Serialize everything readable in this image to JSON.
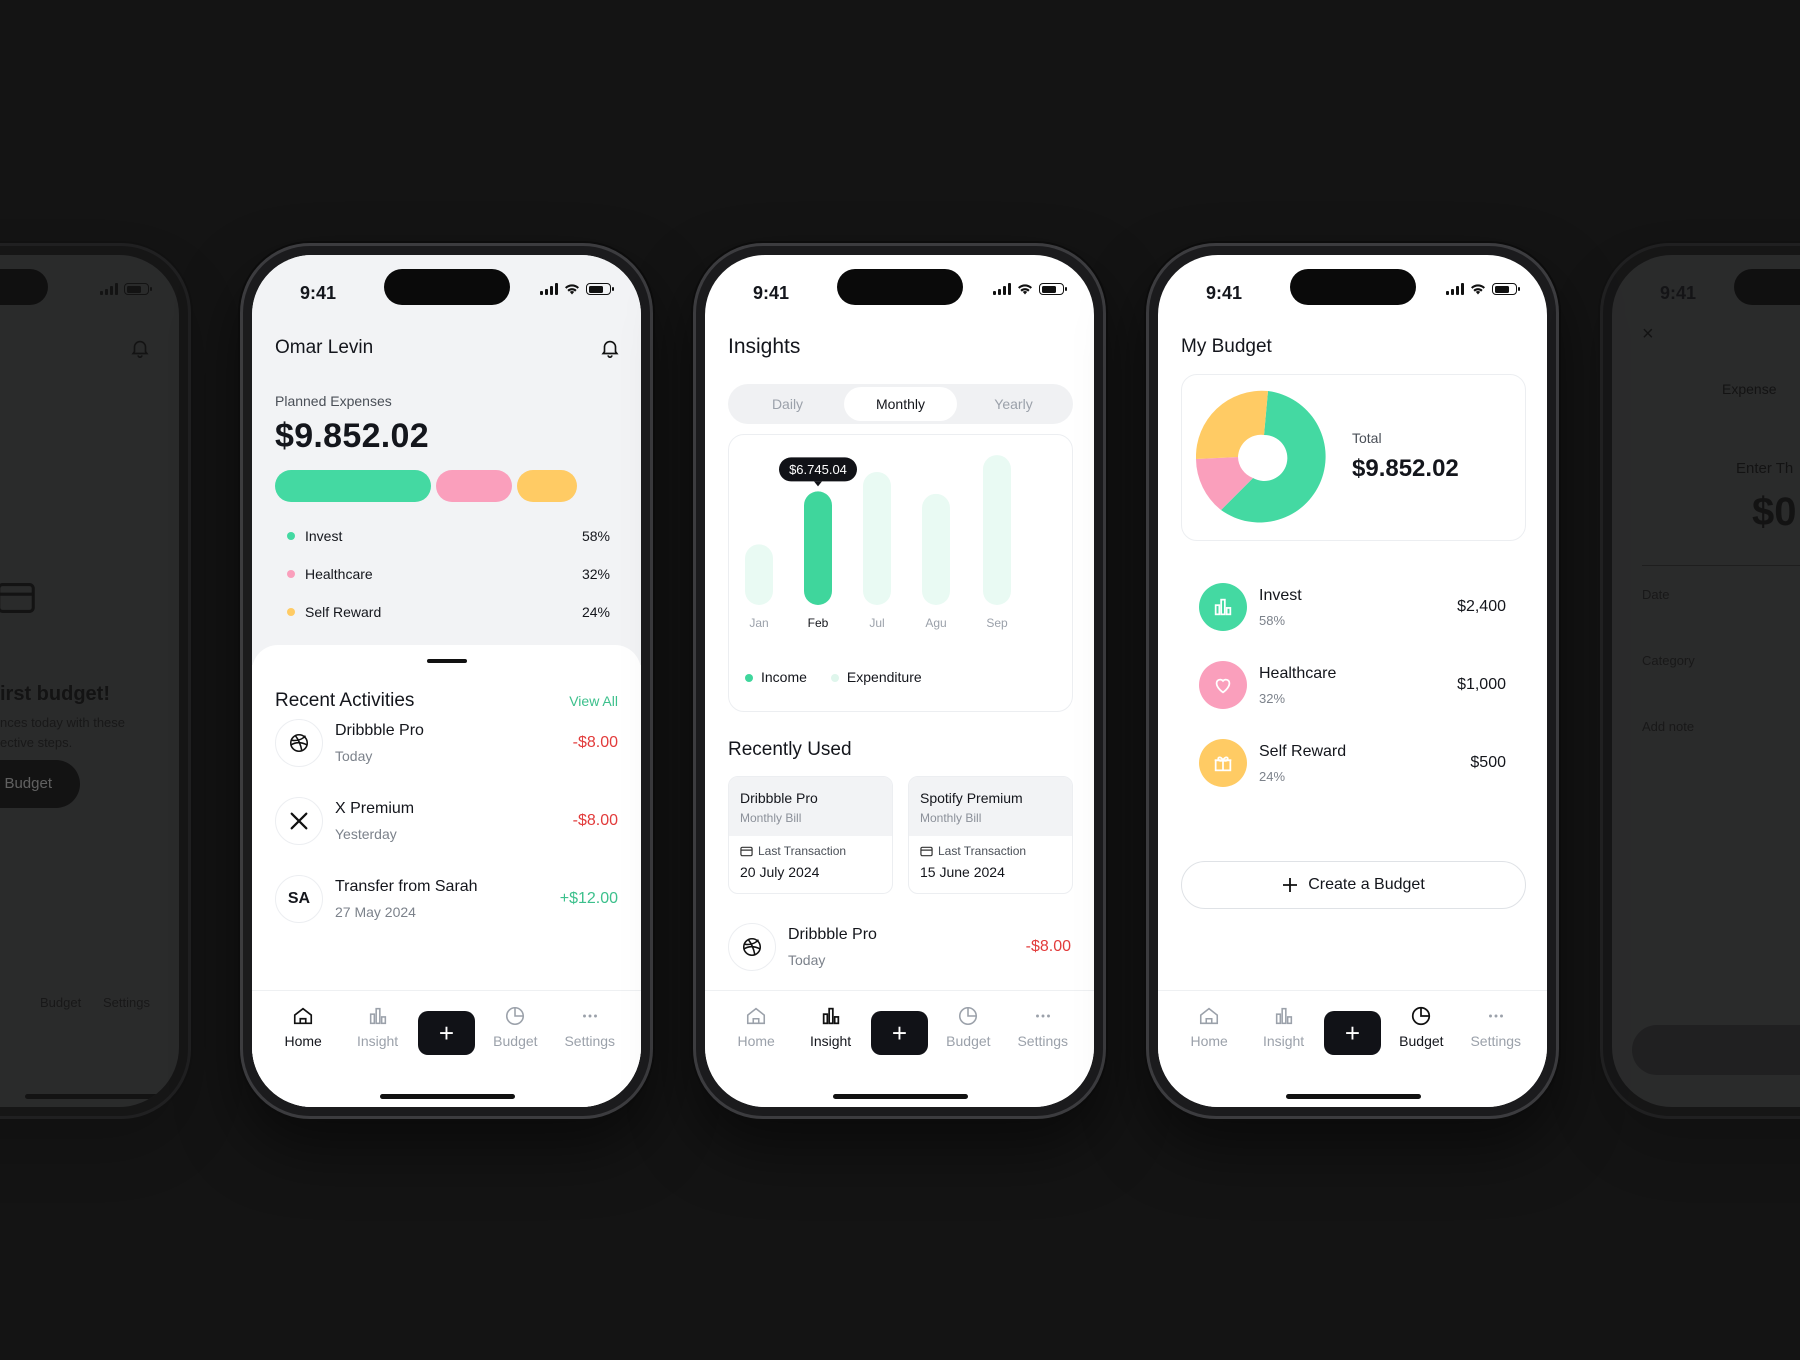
{
  "status_time": "9:41",
  "tabs": {
    "home": "Home",
    "insight": "Insight",
    "add": "+",
    "budget": "Budget",
    "settings": "Settings"
  },
  "home": {
    "user": "Omar Levin",
    "planned_label": "Planned Expenses",
    "planned_amount": "$9.852.02",
    "categories": [
      {
        "name": "Invest",
        "pct": "58%",
        "color": "#44d9a2"
      },
      {
        "name": "Healthcare",
        "pct": "32%",
        "color": "#fa9fbc"
      },
      {
        "name": "Self Reward",
        "pct": "24%",
        "color": "#ffcb64"
      }
    ],
    "recent_title": "Recent Activities",
    "view_all": "View All",
    "activities": [
      {
        "title": "Dribbble Pro",
        "date": "Today",
        "amount": "-$8.00"
      },
      {
        "title": "X Premium",
        "date": "Yesterday",
        "amount": "-$8.00"
      },
      {
        "initials": "SA",
        "title": "Transfer from Sarah",
        "date": "27 May 2024",
        "amount": "+$12.00"
      }
    ]
  },
  "insights": {
    "title": "Insights",
    "segments": [
      "Daily",
      "Monthly",
      "Yearly"
    ],
    "selected_segment": "Monthly",
    "tooltip": "$6.745.04",
    "legend": {
      "income": "Income",
      "expenditure": "Expenditure"
    },
    "recent_title": "Recently Used",
    "bills": [
      {
        "name": "Dribbble Pro",
        "type": "Monthly Bill",
        "last_label": "Last Transaction",
        "date": "20 July 2024"
      },
      {
        "name": "Spotify Premium",
        "type": "Monthly Bill",
        "last_label": "Last Transaction",
        "date": "15 June 2024"
      }
    ],
    "last_activity": {
      "title": "Dribbble Pro",
      "date": "Today",
      "amount": "-$8.00"
    }
  },
  "chart_data": {
    "type": "bar",
    "categories": [
      "Jan",
      "Feb",
      "Jul",
      "Agu",
      "Sep"
    ],
    "series": [
      {
        "name": "Income",
        "values": [
          null,
          6745.04,
          null,
          null,
          null
        ]
      },
      {
        "name": "Expenditure",
        "values": [
          3600,
          6745.04,
          7900,
          6600,
          8900
        ]
      }
    ],
    "highlighted": "Feb",
    "colors": {
      "income": "#3fd69c",
      "expenditure": "#e9faf3"
    }
  },
  "budget": {
    "title": "My Budget",
    "total_label": "Total",
    "total_amount": "$9.852.02",
    "items": [
      {
        "name": "Invest",
        "pct": "58%",
        "amount": "$2,400",
        "icon": "bar-chart-icon",
        "color": "#44d9a2"
      },
      {
        "name": "Healthcare",
        "pct": "32%",
        "amount": "$1,000",
        "icon": "heart-icon",
        "color": "#fa9fbc"
      },
      {
        "name": "Self Reward",
        "pct": "24%",
        "amount": "$500",
        "icon": "gift-icon",
        "color": "#ffcb64"
      }
    ],
    "create_label": "Create a Budget"
  },
  "ghost_left": {
    "heading": "irst budget!",
    "line1": "nces today with these",
    "line2": "ective steps.",
    "button": "Budget",
    "tab_budget": "Budget",
    "tab_settings": "Settings"
  },
  "ghost_right": {
    "expense": "Expense",
    "enter": "Enter Th",
    "amount": "$0",
    "field1": "Date",
    "field2": "Category",
    "field3": "Add note"
  }
}
